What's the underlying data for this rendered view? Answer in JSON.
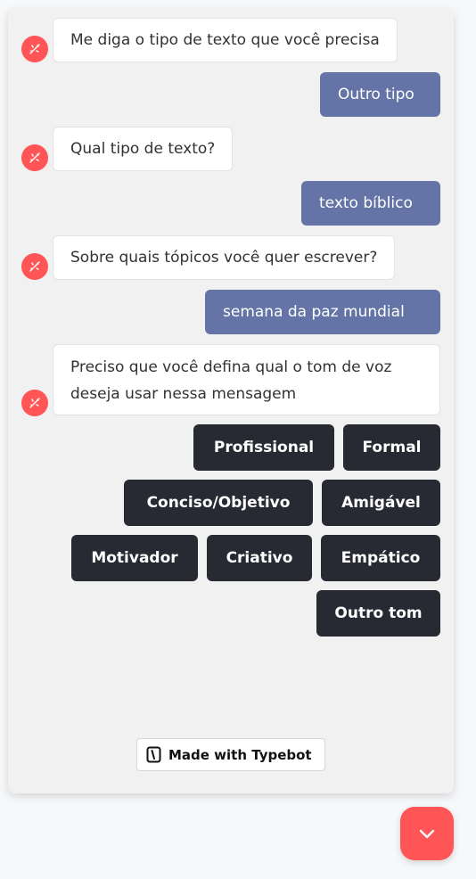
{
  "colors": {
    "bot_avatar": "#ff5556",
    "user_bubble": "#6574a6",
    "choice_button": "#272a33",
    "launcher": "#ff5556"
  },
  "messages": [
    {
      "from": "bot",
      "text": "Me diga o tipo de texto que você precisa"
    },
    {
      "from": "user",
      "text": "Outro tipo"
    },
    {
      "from": "bot",
      "text": "Qual tipo de texto?"
    },
    {
      "from": "user",
      "text": "texto bíblico"
    },
    {
      "from": "bot",
      "text": "Sobre quais tópicos você quer escrever?"
    },
    {
      "from": "user",
      "text": "semana da paz mundial"
    },
    {
      "from": "bot",
      "text": "Preciso que você defina qual o tom de voz deseja usar nessa mensagem"
    }
  ],
  "choices": [
    "Profissional",
    "Formal",
    "Conciso/Objetivo",
    "Amigável",
    "Motivador",
    "Criativo",
    "Empático",
    "Outro tom"
  ],
  "branding": {
    "label": "Made with Typebot",
    "icon": "typebot-logo-icon"
  },
  "launcher": {
    "icon": "chevron-down-icon"
  }
}
